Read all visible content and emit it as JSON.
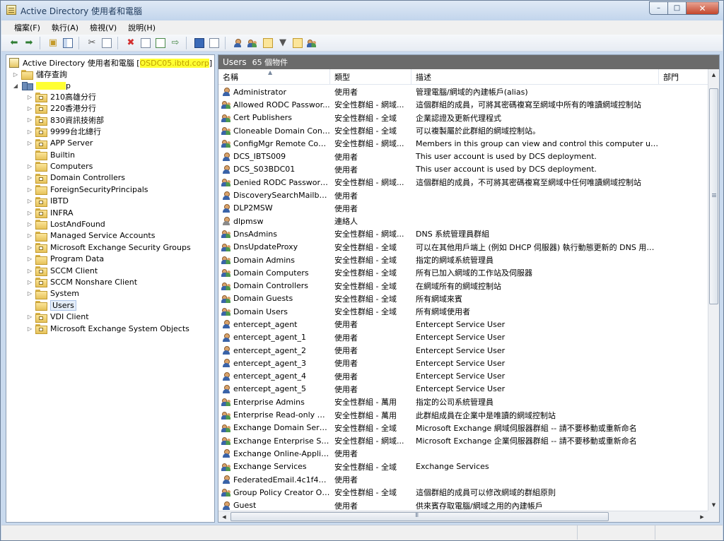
{
  "window": {
    "title": "Active Directory 使用者和電腦"
  },
  "window_buttons": {
    "minimize": "–",
    "maximize": "□",
    "close": "✕"
  },
  "menu": [
    "檔案(F)",
    "執行(A)",
    "檢視(V)",
    "說明(H)"
  ],
  "toolbar": [
    "back-icon",
    "forward-icon",
    "up-folder-icon",
    "show-tree-icon",
    "cut-icon",
    "copy-icon",
    "delete-icon",
    "properties-icon",
    "refresh-icon",
    "export-icon",
    "help-icon",
    "console-icon",
    "new-user-icon",
    "new-group-icon",
    "new-ou-icon",
    "filter-icon",
    "find-icon",
    "add-to-group-icon"
  ],
  "tree": {
    "root_label": "Active Directory 使用者和電腦 [",
    "root_server": "OSDC05.ibtd.corp",
    "root_suffix": "]",
    "saved_queries": "儲存查詢",
    "domain_suffix": "p",
    "items": [
      {
        "label": "210高雄分行",
        "type": "ou",
        "expandable": true
      },
      {
        "label": "220香港分行",
        "type": "ou",
        "expandable": true
      },
      {
        "label": "830資訊技術部",
        "type": "ou",
        "expandable": true
      },
      {
        "label": "9999台北總行",
        "type": "ou",
        "expandable": true
      },
      {
        "label": "APP Server",
        "type": "ou",
        "expandable": true
      },
      {
        "label": "Builtin",
        "type": "folder",
        "expandable": false
      },
      {
        "label": "Computers",
        "type": "folder",
        "expandable": true
      },
      {
        "label": "Domain Controllers",
        "type": "ou",
        "expandable": true
      },
      {
        "label": "ForeignSecurityPrincipals",
        "type": "folder",
        "expandable": true
      },
      {
        "label": "IBTD",
        "type": "ou",
        "expandable": true
      },
      {
        "label": "INFRA",
        "type": "ou",
        "expandable": true
      },
      {
        "label": "LostAndFound",
        "type": "folder",
        "expandable": true
      },
      {
        "label": "Managed Service Accounts",
        "type": "folder",
        "expandable": true
      },
      {
        "label": "Microsoft Exchange Security Groups",
        "type": "ou",
        "expandable": true
      },
      {
        "label": "Program Data",
        "type": "folder",
        "expandable": true
      },
      {
        "label": "SCCM Client",
        "type": "ou",
        "expandable": true
      },
      {
        "label": "SCCM Nonshare Client",
        "type": "ou",
        "expandable": true
      },
      {
        "label": "System",
        "type": "folder",
        "expandable": true
      },
      {
        "label": "Users",
        "type": "folder",
        "expandable": false,
        "selected": true
      },
      {
        "label": "VDI Client",
        "type": "ou",
        "expandable": true
      },
      {
        "label": "Microsoft Exchange System Objects",
        "type": "ou",
        "expandable": true
      }
    ]
  },
  "list": {
    "header": "Users",
    "count": "65 個物件",
    "columns": [
      "名稱",
      "類型",
      "描述",
      "部門"
    ],
    "rows": [
      {
        "name": "Administrator",
        "type": "使用者",
        "desc": "管理電腦/網域的內建帳戶(alias)",
        "icon": "user"
      },
      {
        "name": "Allowed RODC Passwor...",
        "type": "安全性群組 - 網域...",
        "desc": "這個群組的成員，可將其密碼複寫至網域中所有的唯讀網域控制站",
        "icon": "group"
      },
      {
        "name": "Cert Publishers",
        "type": "安全性群組 - 全域",
        "desc": "企業認證及更新代理程式",
        "icon": "group"
      },
      {
        "name": "Cloneable Domain Cont...",
        "type": "安全性群組 - 全域",
        "desc": "可以複製屬於此群組的網域控制站。",
        "icon": "group"
      },
      {
        "name": "ConfigMgr Remote Con...",
        "type": "安全性群組 - 網域...",
        "desc": "Members in this group can view and control this computer using ...",
        "icon": "group"
      },
      {
        "name": "DCS_IBTS009",
        "type": "使用者",
        "desc": "This user account is used by DCS deployment.",
        "icon": "user"
      },
      {
        "name": "DCS_S03BDC01",
        "type": "使用者",
        "desc": "This user account is used by DCS deployment.",
        "icon": "user"
      },
      {
        "name": "Denied RODC Password ...",
        "type": "安全性群組 - 網域...",
        "desc": "這個群組的成員，不可將其密碼複寫至網域中任何唯讀網域控制站",
        "icon": "group"
      },
      {
        "name": "DiscoverySearchMailbox...",
        "type": "使用者",
        "desc": "",
        "icon": "user"
      },
      {
        "name": "DLP2MSW",
        "type": "使用者",
        "desc": "",
        "icon": "user"
      },
      {
        "name": "dlpmsw",
        "type": "連絡人",
        "desc": "",
        "icon": "contact"
      },
      {
        "name": "DnsAdmins",
        "type": "安全性群組 - 網域...",
        "desc": "DNS 系統管理員群組",
        "icon": "group"
      },
      {
        "name": "DnsUpdateProxy",
        "type": "安全性群組 - 全域",
        "desc": "可以在其他用戶端上 (例如 DHCP 伺服器) 執行動態更新的 DNS 用戶...",
        "icon": "group"
      },
      {
        "name": "Domain Admins",
        "type": "安全性群組 - 全域",
        "desc": "指定的網域系統管理員",
        "icon": "group"
      },
      {
        "name": "Domain Computers",
        "type": "安全性群組 - 全域",
        "desc": "所有已加入網域的工作站及伺服器",
        "icon": "group"
      },
      {
        "name": "Domain Controllers",
        "type": "安全性群組 - 全域",
        "desc": "在網域所有的網域控制站",
        "icon": "group"
      },
      {
        "name": "Domain Guests",
        "type": "安全性群組 - 全域",
        "desc": "所有網域來賓",
        "icon": "group"
      },
      {
        "name": "Domain Users",
        "type": "安全性群組 - 全域",
        "desc": "所有網域使用者",
        "icon": "group"
      },
      {
        "name": "entercept_agent",
        "type": "使用者",
        "desc": "Entercept Service User",
        "icon": "user"
      },
      {
        "name": "entercept_agent_1",
        "type": "使用者",
        "desc": "Entercept Service User",
        "icon": "user"
      },
      {
        "name": "entercept_agent_2",
        "type": "使用者",
        "desc": "Entercept Service User",
        "icon": "user"
      },
      {
        "name": "entercept_agent_3",
        "type": "使用者",
        "desc": "Entercept Service User",
        "icon": "user"
      },
      {
        "name": "entercept_agent_4",
        "type": "使用者",
        "desc": "Entercept Service User",
        "icon": "user"
      },
      {
        "name": "entercept_agent_5",
        "type": "使用者",
        "desc": "Entercept Service User",
        "icon": "user"
      },
      {
        "name": "Enterprise Admins",
        "type": "安全性群組 - 萬用",
        "desc": "指定的公司系統管理員",
        "icon": "group"
      },
      {
        "name": "Enterprise Read-only Do...",
        "type": "安全性群組 - 萬用",
        "desc": "此群組成員在企業中是唯讀的網域控制站",
        "icon": "group"
      },
      {
        "name": "Exchange Domain Servers",
        "type": "安全性群組 - 全域",
        "desc": "Microsoft Exchange 網域伺服器群組 -- 請不要移動或重新命名",
        "icon": "group"
      },
      {
        "name": "Exchange Enterprise Ser...",
        "type": "安全性群組 - 網域...",
        "desc": "Microsoft Exchange 企業伺服器群組 -- 請不要移動或重新命名",
        "icon": "group"
      },
      {
        "name": "Exchange Online-Applic...",
        "type": "使用者",
        "desc": "",
        "icon": "user"
      },
      {
        "name": "Exchange Services",
        "type": "安全性群組 - 全域",
        "desc": "Exchange Services",
        "icon": "group"
      },
      {
        "name": "FederatedEmail.4c1f4d8...",
        "type": "使用者",
        "desc": "",
        "icon": "user"
      },
      {
        "name": "Group Policy Creator Ow...",
        "type": "安全性群組 - 全域",
        "desc": "這個群組的成員可以修改網域的群組原則",
        "icon": "group"
      },
      {
        "name": "Guest",
        "type": "使用者",
        "desc": "供來賓存取電腦/網域之用的內建帳戶",
        "icon": "user"
      }
    ]
  }
}
